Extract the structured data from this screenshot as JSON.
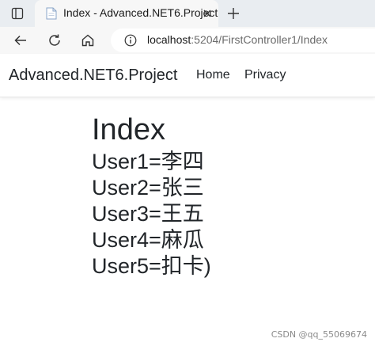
{
  "browser": {
    "tab_title": "Index - Advanced.NET6.Project",
    "address": {
      "host": "localhost",
      "path": ":5204/FirstController1/Index"
    }
  },
  "site": {
    "brand": "Advanced.NET6.Project",
    "nav": [
      "Home",
      "Privacy"
    ]
  },
  "main": {
    "heading": "Index",
    "users": [
      "User1=李四",
      "User2=张三",
      "User3=王五",
      "User4=麻瓜",
      "User5=扣卡)"
    ]
  },
  "watermark": "CSDN @qq_55069674",
  "colors": {
    "tabstrip": "#e9edf1",
    "toolbar": "#f7f7f7",
    "text": "#212529"
  }
}
